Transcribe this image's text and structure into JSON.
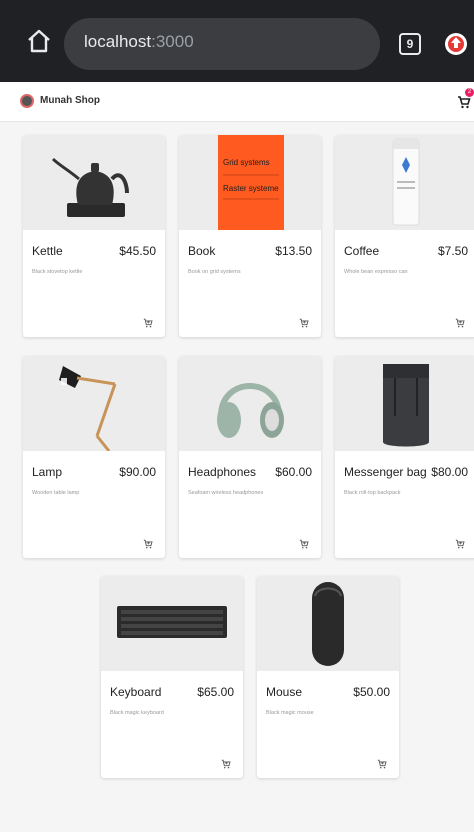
{
  "browser": {
    "host": "localhost",
    "port": ":3000",
    "tab_count": "9"
  },
  "shop": {
    "title": "Munah Shop",
    "cart_count": "2"
  },
  "products": [
    {
      "name": "Kettle",
      "price": "$45.50",
      "desc": "Black stovetop kettle",
      "icon": "kettle-image"
    },
    {
      "name": "Book",
      "price": "$13.50",
      "desc": "Book on grid systems",
      "icon": "book-image"
    },
    {
      "name": "Coffee",
      "price": "$7.50",
      "desc": "Whole bean espresso can",
      "icon": "coffee-image"
    },
    {
      "name": "Lamp",
      "price": "$90.00",
      "desc": "Wooden table lamp",
      "icon": "lamp-image"
    },
    {
      "name": "Headphones",
      "price": "$60.00",
      "desc": "Seafoam wireless headphones",
      "icon": "headphones-image"
    },
    {
      "name": "Messenger bag",
      "price": "$80.00",
      "desc": "Black roll-top backpack",
      "icon": "bag-image"
    },
    {
      "name": "Keyboard",
      "price": "$65.00",
      "desc": "Black magic keyboard",
      "icon": "keyboard-image"
    },
    {
      "name": "Mouse",
      "price": "$50.00",
      "desc": "Black magic mouse",
      "icon": "mouse-image"
    }
  ],
  "book_cover": {
    "line1": "Grid systems",
    "line2": "Raster systeme"
  },
  "colors": {
    "browser_bg": "#202124",
    "badge": "#e91e63",
    "book_cover": "#ff5a1f"
  }
}
